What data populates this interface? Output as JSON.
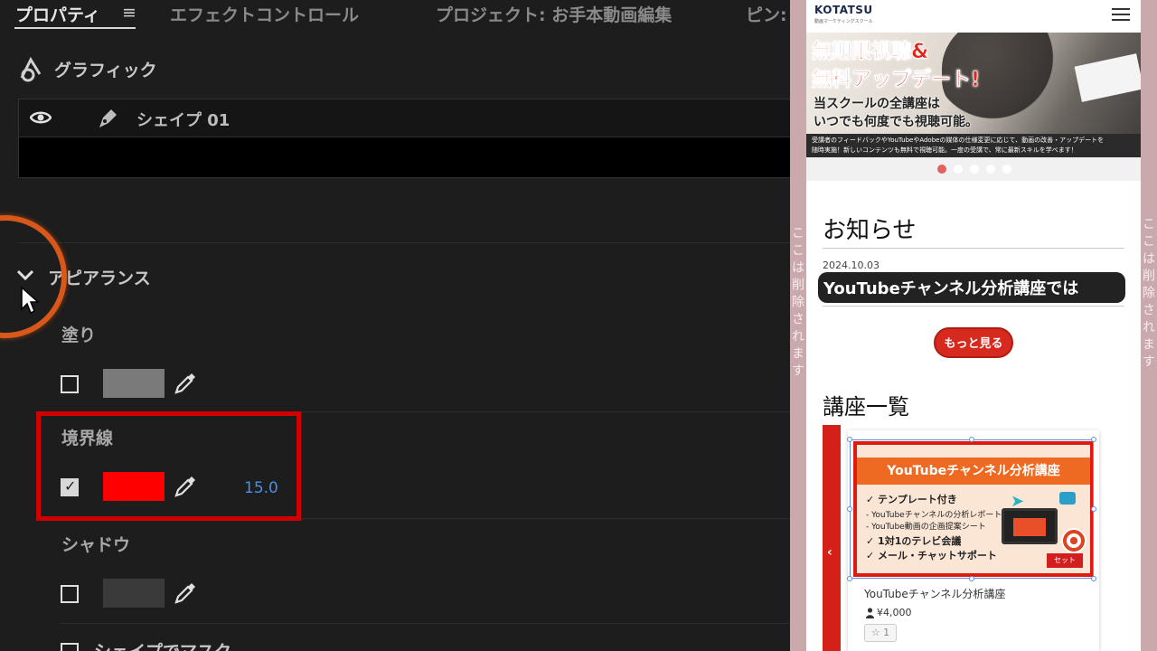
{
  "tabs": {
    "properties": "プロパティ",
    "menu_glyph": "≡",
    "effect_controls": "エフェクトコントロール",
    "project": "プロジェクト: お手本動画編集",
    "pin": "ピン:"
  },
  "graphics": {
    "title": "グラフィック",
    "shape_name": "シェイプ 01"
  },
  "appearance": {
    "title": "アピアランス",
    "fill_label": "塗り",
    "fill_checked": false,
    "fill_color": "#7a7a7a",
    "stroke_label": "境界線",
    "stroke_checked": true,
    "stroke_color": "#ff0000",
    "stroke_width": "15.0",
    "shadow_label": "シャドウ",
    "shadow_checked": false,
    "mask_label": "シェイプでマスク"
  },
  "side_text": "ここは削除されます",
  "site": {
    "logo": "KOTATSU",
    "logo_sub": "動画マーケティングスクール",
    "banner_line1": "無期限視聴&",
    "banner_line2": "無料アップデート!",
    "banner_line3": "当スクールの全講座は",
    "banner_line4": "いつでも何度でも視聴可能。",
    "banner_strip_line1": "受講者のフィードバックやYouTubeやAdobeの媒体の仕様変更に応じて、動画の改善・アップデートを",
    "banner_strip_line2": "随時実施！新しいコンテンツも無料で視聴可能。一度の受講で、常に最新スキルを学べます！",
    "news_title": "お知らせ",
    "news_date": "2024.10.03",
    "news_headline": "YouTubeチャンネル分析講座では",
    "more_button": "もっと見る",
    "courses_title": "講座一覧",
    "carousel_arrow": "‹",
    "course": {
      "thumb_title": "YouTubeチャンネル分析講座",
      "line1": "✓ テンプレート付き",
      "line2": "- YouTubeチャンネルの分析レポート",
      "line3": "- YouTube動画の企画提案シート",
      "line4": "✓ 1対1のテレビ会議",
      "line5": "✓ メール・チャットサポート",
      "badge": "セット",
      "name": "YouTubeチャンネル分析講座",
      "price": "¥4,000",
      "favorites": "☆ 1"
    }
  }
}
